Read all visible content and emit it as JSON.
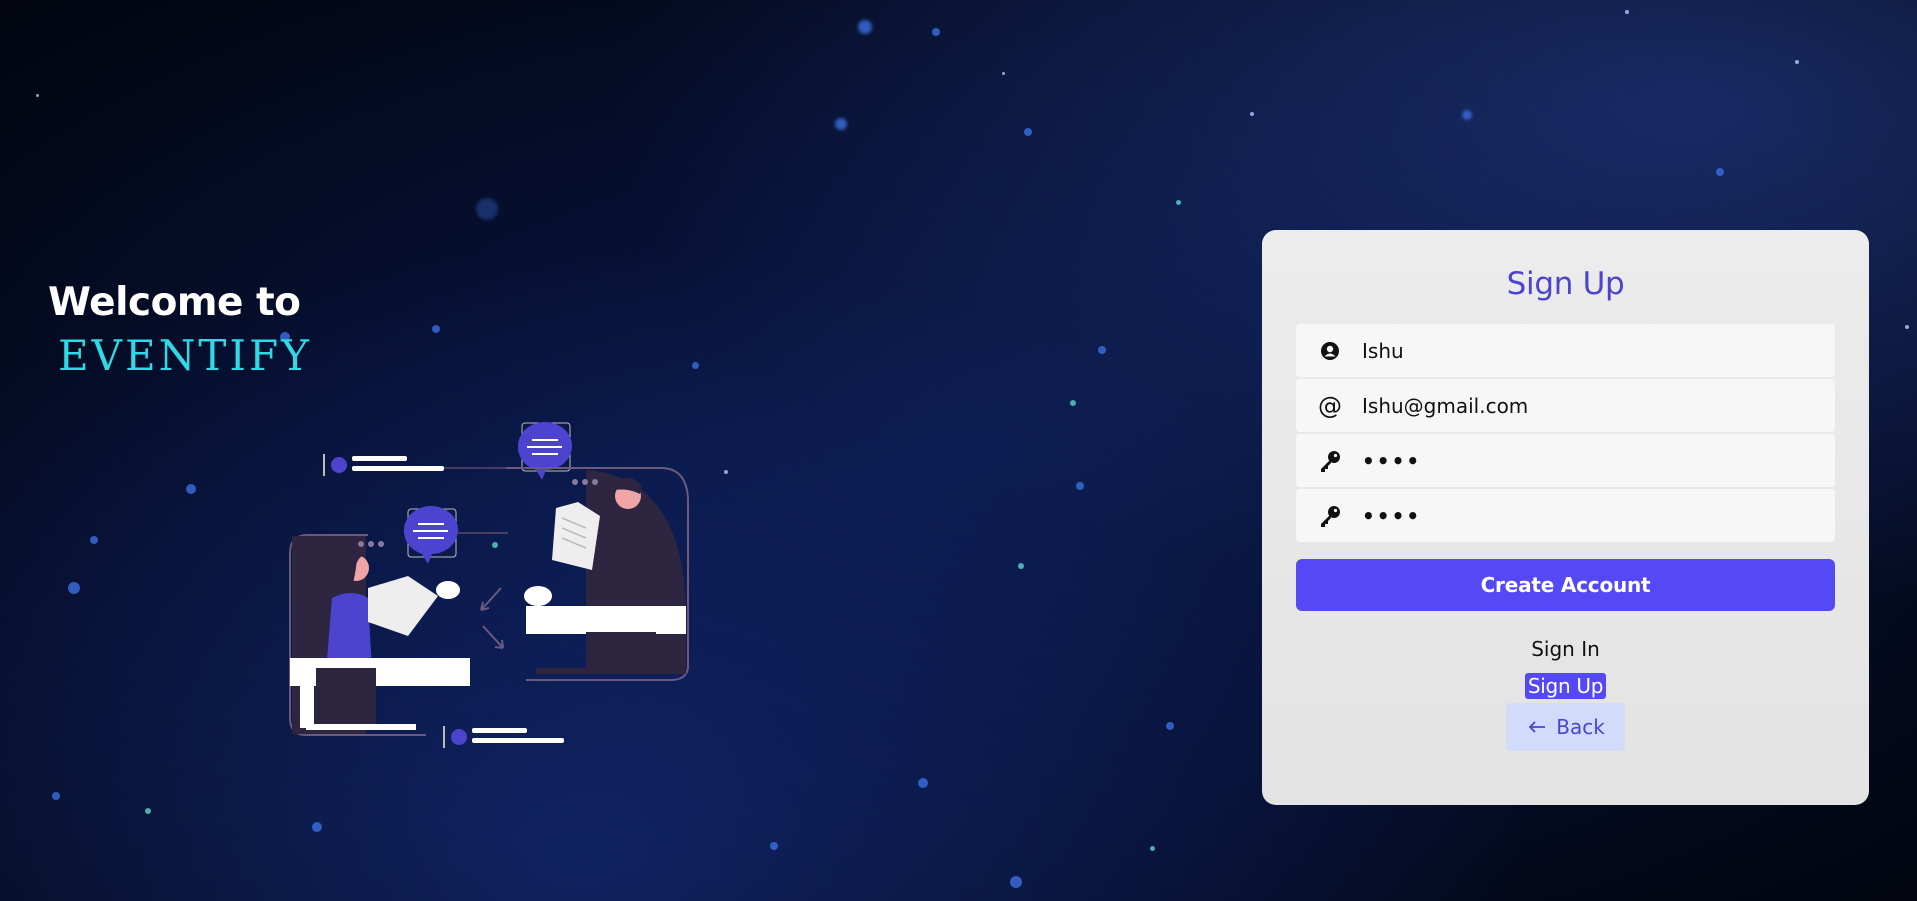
{
  "hero": {
    "welcome": "Welcome to",
    "brand": "EVENTIFY"
  },
  "form": {
    "title": "Sign Up",
    "fields": [
      {
        "icon": "user-circle-icon",
        "value": "Ishu"
      },
      {
        "icon": "at-sign-icon",
        "value": "Ishu@gmail.com"
      },
      {
        "icon": "key-icon",
        "value": "••••"
      },
      {
        "icon": "key-icon",
        "value": "••••"
      }
    ],
    "submit_label": "Create Account",
    "signin_label": "Sign In",
    "signup_label": "Sign Up",
    "back_label": "Back"
  },
  "colors": {
    "accent": "#5549f5",
    "title": "#4c44cf",
    "brand": "#2fd9e6",
    "back_bg": "#d3dbfb"
  }
}
